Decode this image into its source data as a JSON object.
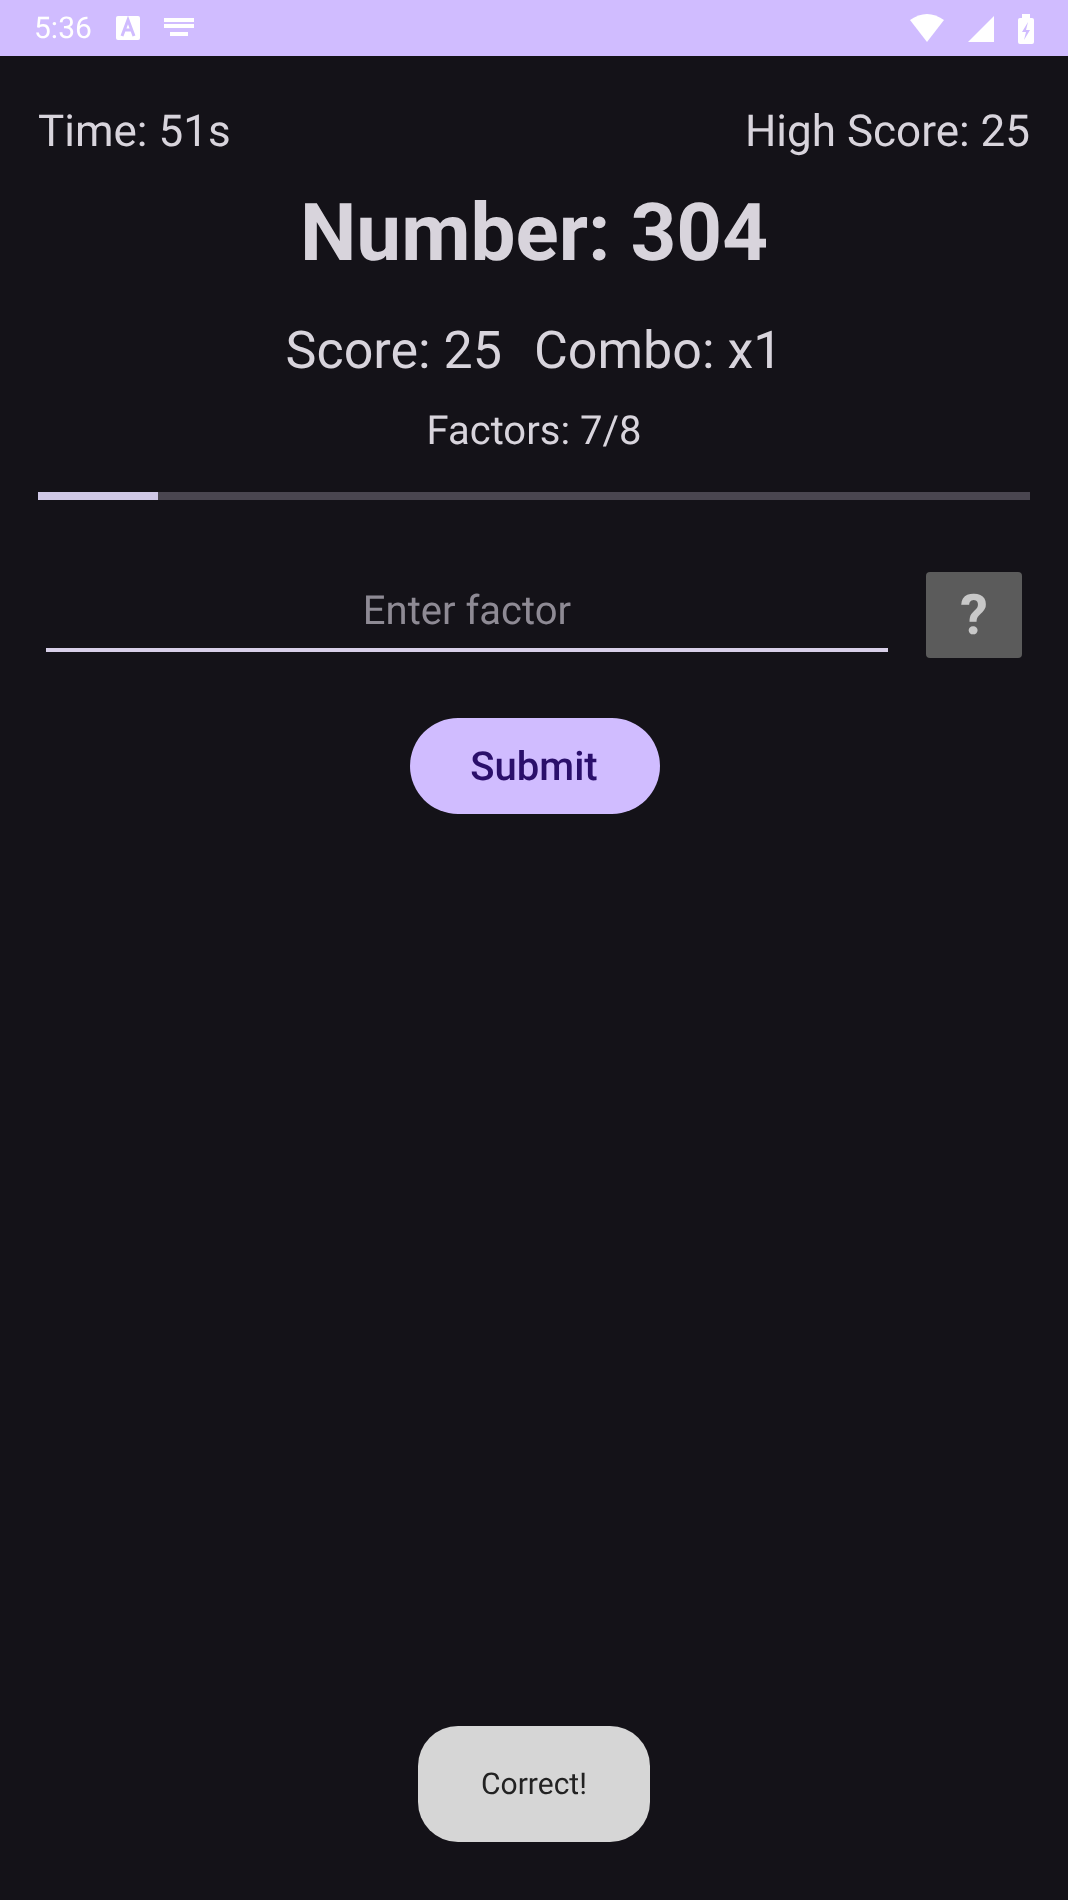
{
  "status_bar": {
    "time": "5:36"
  },
  "header": {
    "time": "Time: 51s",
    "high_score": "High Score: 25"
  },
  "number": "Number: 304",
  "score": "Score: 25",
  "combo": "Combo: x1",
  "factors": "Factors: 7/8",
  "progress": {
    "level": 0.12
  },
  "input": {
    "placeholder": "Enter factor",
    "focused": true
  },
  "help_button": "?",
  "submit_button": "Submit",
  "toast": "Correct!"
}
